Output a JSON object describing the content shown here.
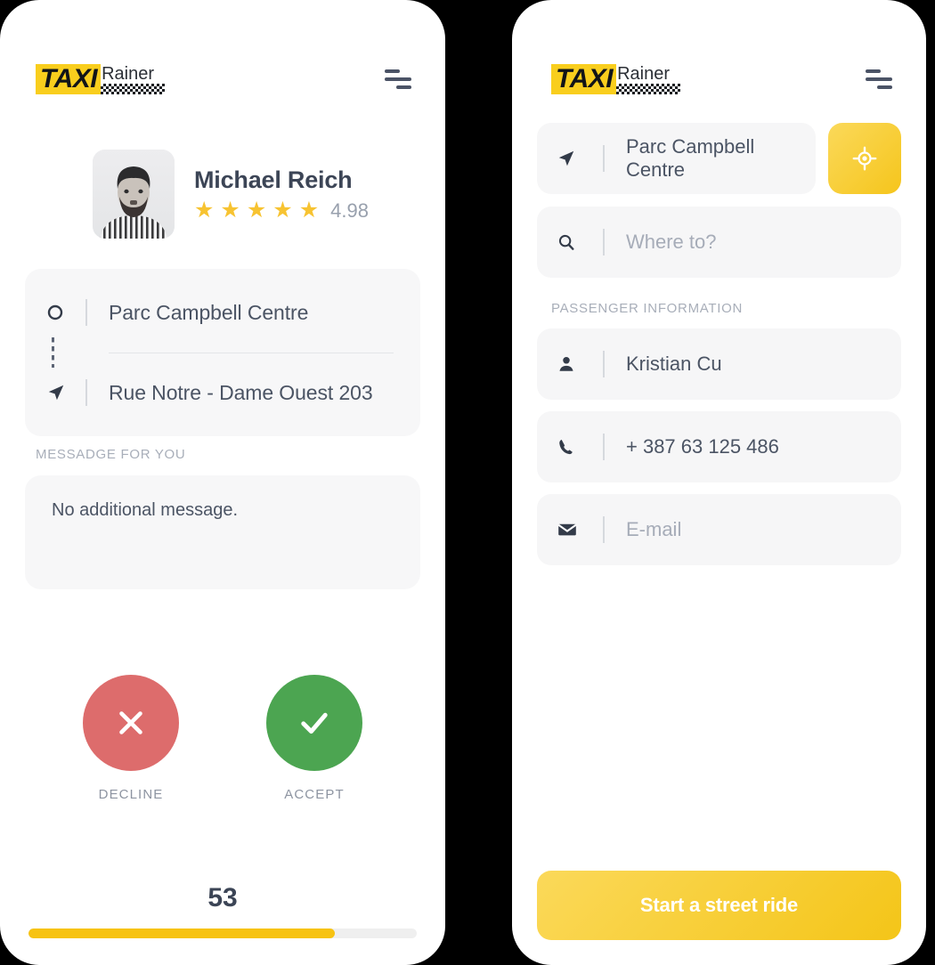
{
  "brand": {
    "logo_taxi": "TAXI",
    "logo_rainer": "Rainer",
    "accent_yellow": "#F9CE1D",
    "text_navy": "#3c4556"
  },
  "left_screen": {
    "menu_icon": "hamburger-menu-icon",
    "driver": {
      "name": "Michael Reich",
      "rating_value": "4.98",
      "stars": [
        "★",
        "★",
        "★",
        "★",
        "★"
      ],
      "avatar_alt": "driver-photo"
    },
    "route": {
      "pickup_icon": "circle-outline-icon",
      "pickup": "Parc Campbell Centre",
      "dropoff_icon": "navigation-arrow-icon",
      "dropoff": "Rue Notre - Dame Ouest 203"
    },
    "message": {
      "label": "MESSADGE FOR YOU",
      "body": "No additional message."
    },
    "actions": {
      "decline_label": "DECLINE",
      "decline_icon": "close-x-icon",
      "decline_color": "#DD6C6C",
      "accept_label": "ACCEPT",
      "accept_icon": "check-icon",
      "accept_color": "#4CA551"
    },
    "countdown": {
      "seconds": "53",
      "progress_percent": 79,
      "fill_color": "#F7C313"
    }
  },
  "right_screen": {
    "menu_icon": "hamburger-menu-icon",
    "pickup_field": {
      "icon": "navigation-arrow-icon",
      "value": "Parc Campbell Centre"
    },
    "gps_button": {
      "icon": "crosshair-target-icon"
    },
    "destination_field": {
      "icon": "search-icon",
      "placeholder": "Where to?"
    },
    "passenger_label": "PASSENGER INFORMATION",
    "passenger_fields": [
      {
        "icon": "person-icon",
        "value": "Kristian Cu",
        "placeholder": ""
      },
      {
        "icon": "phone-icon",
        "value": "+ 387 63 125 486",
        "placeholder": ""
      },
      {
        "icon": "envelope-icon",
        "value": "",
        "placeholder": "E-mail"
      }
    ],
    "primary_button": {
      "label": "Start a street ride"
    }
  }
}
